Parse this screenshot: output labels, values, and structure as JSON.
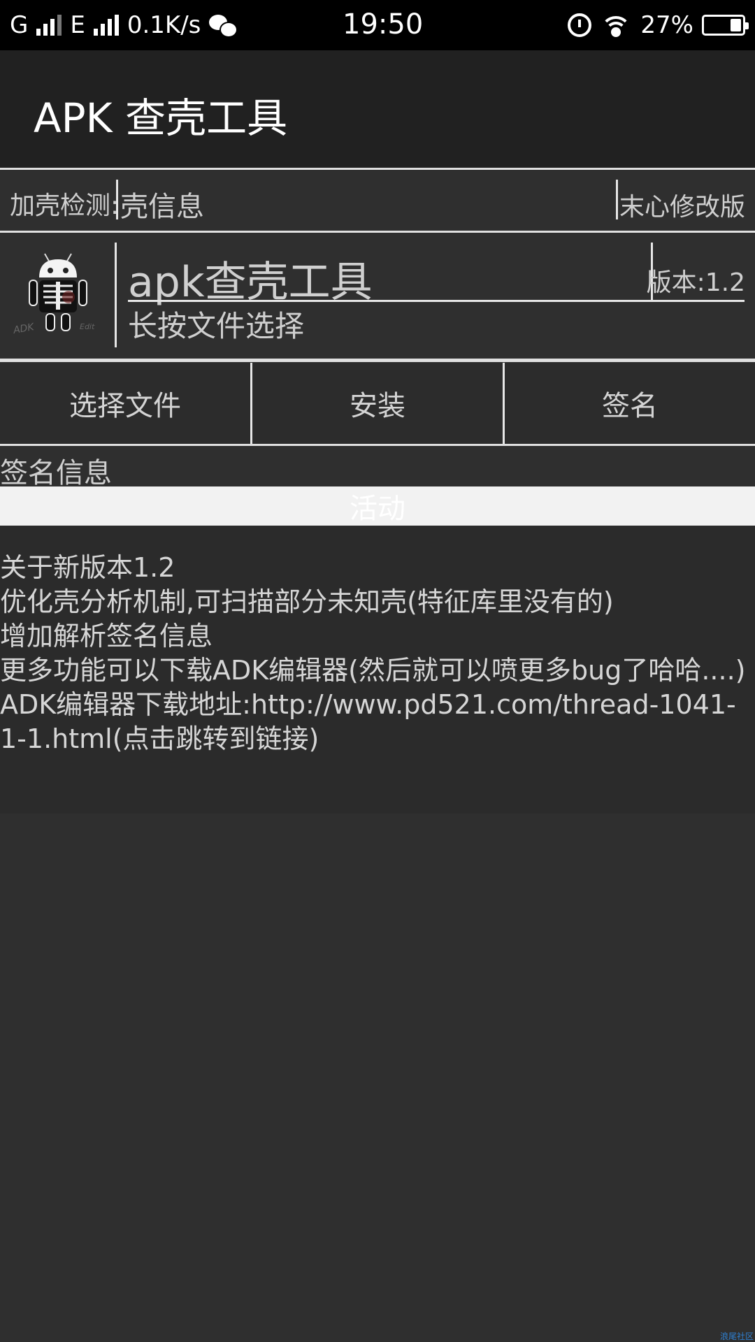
{
  "status_bar": {
    "network1": "G",
    "network2": "E",
    "speed": "0.1K/s",
    "time": "19:50",
    "battery_percent": "27%",
    "battery_level": 0.27,
    "icons": [
      "signal-icon",
      "wechat-icon",
      "alarm-icon",
      "wifi-icon",
      "battery-icon"
    ]
  },
  "action_bar": {
    "title": "APK 查壳工具"
  },
  "detect": {
    "label": "加壳检测:",
    "value": "壳信息",
    "mod_label": "末心修改版"
  },
  "app_info": {
    "name": "apk查壳工具",
    "version": "版本:1.2",
    "hint": "长按文件选择"
  },
  "buttons": {
    "select_file": "选择文件",
    "install": "安装",
    "sign": "签名"
  },
  "signature_info": "签名信息",
  "active_label": "活动",
  "notes": [
    "关于新版本1.2",
    "优化壳分析机制,可扫描部分未知壳(特征库里没有的)",
    "增加解析签名信息",
    "更多功能可以下载ADK编辑器(然后就可以喷更多bug了哈哈....)",
    "ADK编辑器下载地址:http://www.pd521.com/thread-1041-1-1.html(点击跳转到链接)"
  ],
  "colors": {
    "background": "#2f2f2f",
    "action_bar": "#212121",
    "divider": "#e0e0e0",
    "active_bar": "#f2f2f2"
  }
}
